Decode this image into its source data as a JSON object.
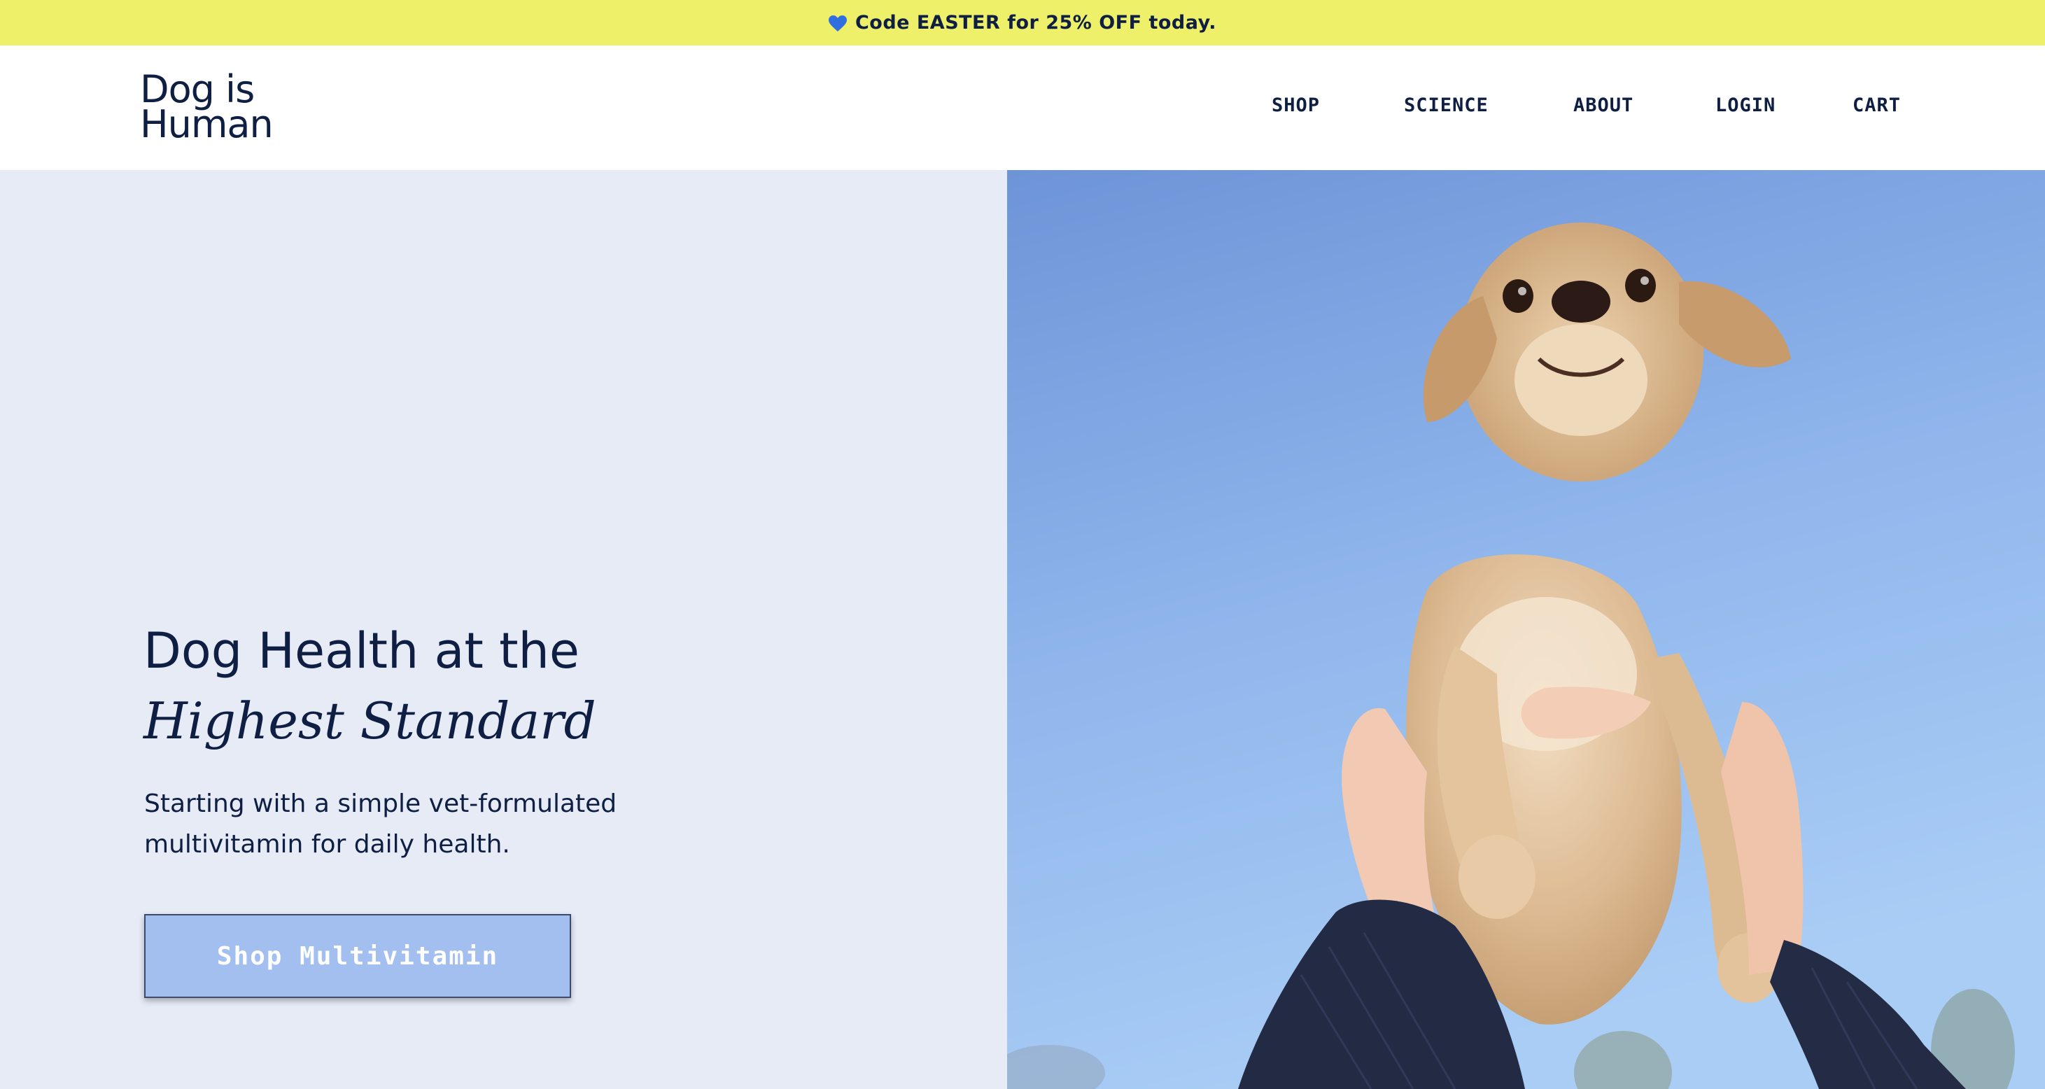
{
  "promo": {
    "icon": "blue-heart-icon",
    "text": "Code EASTER for 25% OFF today."
  },
  "header": {
    "logo_line1": "Dog is",
    "logo_line2": "Human",
    "nav": [
      {
        "label": "SHOP"
      },
      {
        "label": "SCIENCE"
      },
      {
        "label": "ABOUT"
      },
      {
        "label": "LOGIN"
      },
      {
        "label": "CART"
      }
    ]
  },
  "hero": {
    "headline_line1": "Dog Health at the",
    "headline_line2": "Highest Standard",
    "subtext": "Starting with a simple vet-formulated multivitamin for daily health.",
    "cta_label": "Shop Multivitamin",
    "image": "dog-held-up-against-sky-photo"
  },
  "colors": {
    "promo_bg": "#eff06a",
    "navy": "#0f1f44",
    "hero_bg": "#e6ebf6",
    "cta_bg": "#a3bff0",
    "sky": "#8fb3ea"
  }
}
